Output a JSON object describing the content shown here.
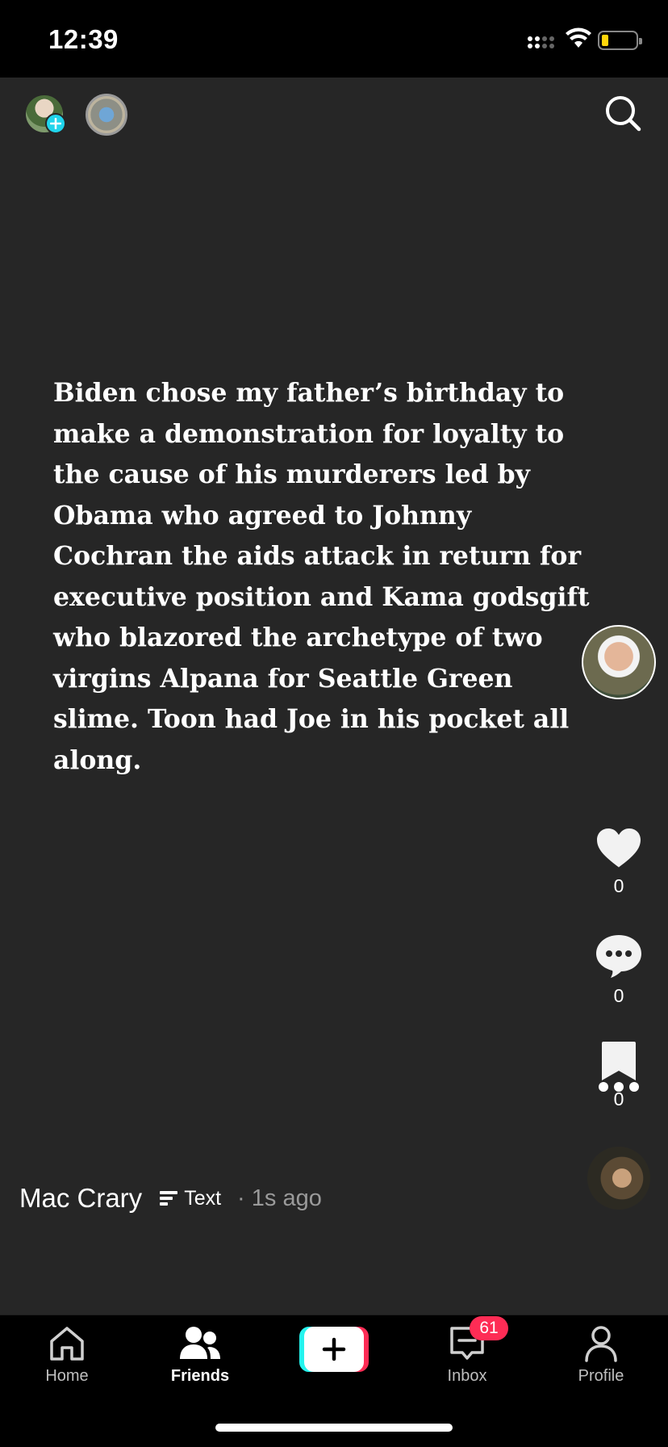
{
  "status_bar": {
    "time": "12:39"
  },
  "post": {
    "text": "Biden chose my father’s birthday to make a demonstration for loyalty to the cause of his murderers led by Obama who agreed to Johnny Cochran the aids attack in return for executive position and Kama godsgift who blazored the archetype of two virgins Alpana for Seattle Green slime.  Toon had Joe in his pocket all along.",
    "author": "Mac Crary",
    "type_label": "Text",
    "time_ago": "· 1s ago"
  },
  "actions": {
    "likes": "0",
    "comments": "0",
    "saves": "0"
  },
  "tabbar": {
    "home": "Home",
    "friends": "Friends",
    "inbox": "Inbox",
    "inbox_badge": "61",
    "profile": "Profile"
  },
  "colors": {
    "background": "#262626",
    "accent_cyan": "#25f4ee",
    "accent_red": "#fe2c55",
    "battery_yellow": "#ffd60a"
  },
  "icons": [
    "signal-icon",
    "wifi-icon",
    "battery-icon",
    "search-icon",
    "heart-icon",
    "comment-icon",
    "bookmark-icon",
    "more-icon",
    "home-icon",
    "friends-icon",
    "plus-icon",
    "inbox-icon",
    "profile-icon"
  ]
}
